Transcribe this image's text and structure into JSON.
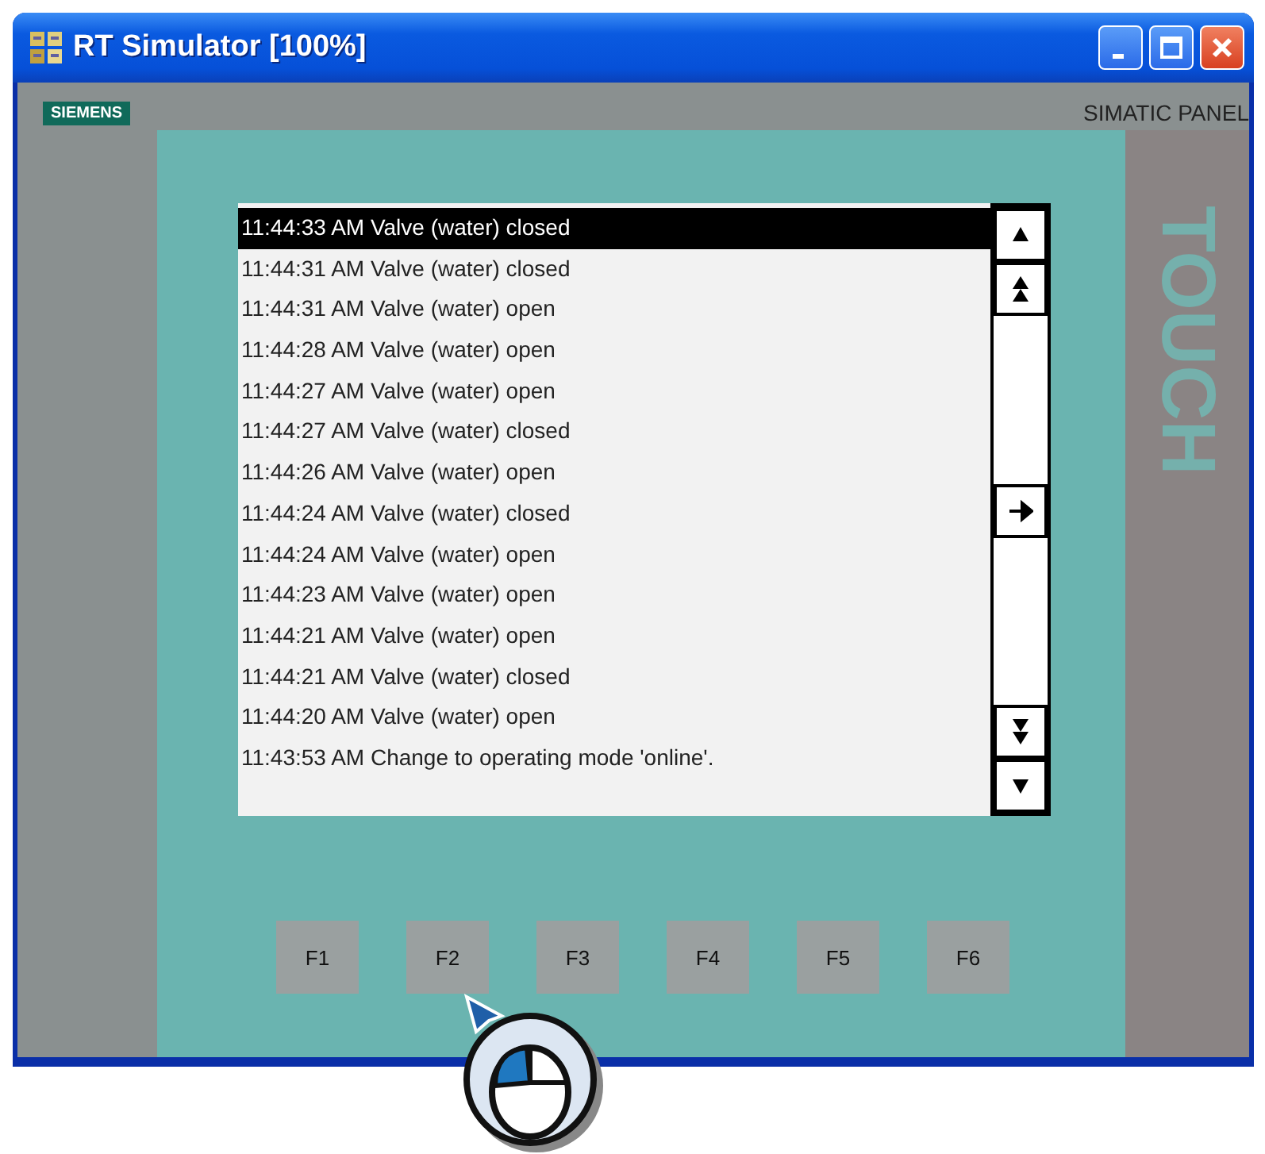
{
  "window": {
    "title": "RT Simulator [100%]"
  },
  "panel": {
    "brand": "SIEMENS",
    "model": "SIMATIC PANEL",
    "side_label": "TOUCH"
  },
  "alarm_list": {
    "rows": [
      {
        "text": "11:44:33 AM Valve (water) closed",
        "selected": true
      },
      {
        "text": "11:44:31 AM Valve (water) closed",
        "selected": false
      },
      {
        "text": "11:44:31 AM Valve (water) open",
        "selected": false
      },
      {
        "text": "11:44:28 AM Valve (water) open",
        "selected": false
      },
      {
        "text": "11:44:27 AM Valve (water) open",
        "selected": false
      },
      {
        "text": "11:44:27 AM Valve (water) closed",
        "selected": false
      },
      {
        "text": "11:44:26 AM Valve (water) open",
        "selected": false
      },
      {
        "text": "11:44:24 AM Valve (water) closed",
        "selected": false
      },
      {
        "text": "11:44:24 AM Valve (water) open",
        "selected": false
      },
      {
        "text": "11:44:23 AM Valve (water) open",
        "selected": false
      },
      {
        "text": "11:44:21 AM Valve (water) open",
        "selected": false
      },
      {
        "text": "11:44:21 AM Valve (water) closed",
        "selected": false
      },
      {
        "text": "11:44:20 AM Valve (water) open",
        "selected": false
      },
      {
        "text": "11:43:53 AM Change to operating mode 'online'.",
        "selected": false
      }
    ],
    "scroll_buttons": [
      {
        "kind": "up"
      },
      {
        "kind": "page-up"
      },
      {
        "kind": "gap"
      },
      {
        "kind": "enter"
      },
      {
        "kind": "gap"
      },
      {
        "kind": "page-down"
      },
      {
        "kind": "down"
      }
    ]
  },
  "function_keys": [
    "F1",
    "F2",
    "F3",
    "F4",
    "F5",
    "F6"
  ]
}
